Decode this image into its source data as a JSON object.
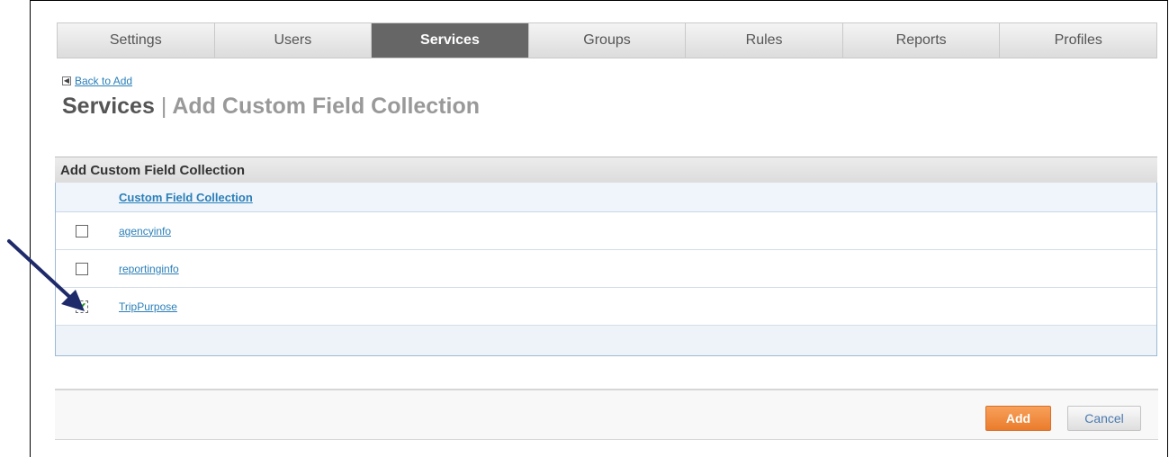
{
  "tabs": [
    {
      "label": "Settings",
      "active": false
    },
    {
      "label": "Users",
      "active": false
    },
    {
      "label": "Services",
      "active": true
    },
    {
      "label": "Groups",
      "active": false
    },
    {
      "label": "Rules",
      "active": false
    },
    {
      "label": "Reports",
      "active": false
    },
    {
      "label": "Profiles",
      "active": false
    }
  ],
  "back_link": "Back to Add",
  "page_title": {
    "section": "Services",
    "separator": "|",
    "subtitle": "Add Custom Field Collection"
  },
  "panel": {
    "title": "Add Custom Field Collection",
    "column_header": "Custom Field Collection",
    "rows": [
      {
        "name": "agencyinfo",
        "checked": false
      },
      {
        "name": "reportinginfo",
        "checked": false
      },
      {
        "name": "TripPurpose",
        "checked": true
      }
    ]
  },
  "buttons": {
    "add": "Add",
    "cancel": "Cancel"
  },
  "colors": {
    "active_tab": "#666666",
    "link": "#2a7fb8",
    "add_button": "#f08c3c",
    "arrow": "#1f2a6b"
  }
}
